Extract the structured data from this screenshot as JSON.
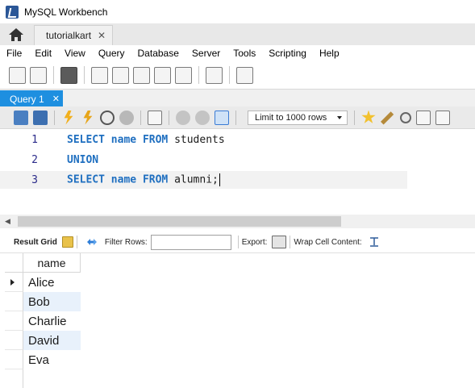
{
  "window": {
    "title": "MySQL Workbench"
  },
  "connection_tab": {
    "label": "tutorialkart",
    "close_glyph": "✕"
  },
  "menu": [
    "File",
    "Edit",
    "View",
    "Query",
    "Database",
    "Server",
    "Tools",
    "Scripting",
    "Help"
  ],
  "query_tab": {
    "label": "Query 1",
    "close_glyph": "✕"
  },
  "editor_toolbar": {
    "limit_label": "Limit to 1000 rows"
  },
  "editor": {
    "lines": [
      {
        "number": "1",
        "tokens": [
          {
            "t": "SELECT",
            "kw": true
          },
          {
            "t": " "
          },
          {
            "t": "name",
            "kw": true
          },
          {
            "t": " "
          },
          {
            "t": "FROM",
            "kw": true
          },
          {
            "t": " students"
          }
        ]
      },
      {
        "number": "2",
        "tokens": [
          {
            "t": "UNION",
            "kw": true
          }
        ]
      },
      {
        "number": "3",
        "tokens": [
          {
            "t": "SELECT",
            "kw": true
          },
          {
            "t": " "
          },
          {
            "t": "name",
            "kw": true
          },
          {
            "t": " "
          },
          {
            "t": "FROM",
            "kw": true
          },
          {
            "t": " alumni;"
          }
        ]
      }
    ],
    "active_line": 2
  },
  "result_toolbar": {
    "grid_label": "Result Grid",
    "filter_label": "Filter Rows:",
    "filter_value": "",
    "export_label": "Export:",
    "wrap_label": "Wrap Cell Content:"
  },
  "grid": {
    "columns": [
      "name"
    ],
    "rows": [
      "Alice",
      "Bob",
      "Charlie",
      "David",
      "Eva"
    ],
    "selected_row": 0
  },
  "colors": {
    "query_tab_bg": "#1e8fe0",
    "keyword": "#1f6fc0",
    "line_number": "#2b2b8a",
    "alt_row": "#e8f1fb"
  }
}
